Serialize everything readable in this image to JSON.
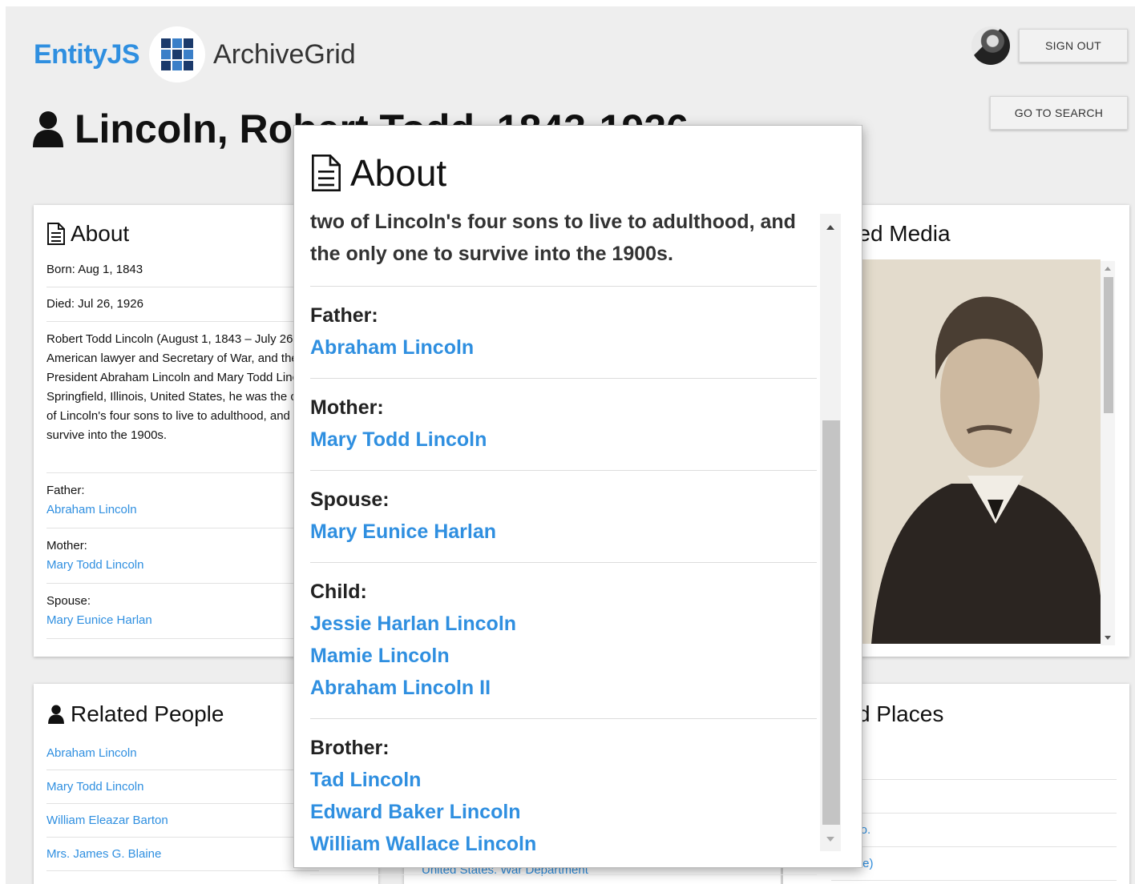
{
  "header": {
    "brand_primary": "EntityJS",
    "brand_secondary": "ArchiveGrid",
    "sign_out": "SIGN OUT",
    "go_to_search": "GO TO SEARCH"
  },
  "page_title": "Lincoln, Robert Todd, 1843-1926",
  "about_card": {
    "title": "About",
    "born": "Born: Aug 1, 1843",
    "died": "Died: Jul 26, 1926",
    "bio": "Robert Todd Lincoln (August 1, 1843 – July 26, 1926) was an American lawyer and Secretary of War, and the first son of President Abraham Lincoln and Mary Todd Lincoln. Born in Springfield, Illinois, United States, he was the only one of two of Lincoln's four sons to live to adulthood, and the only one to survive into the 1900s.",
    "father_label": "Father:",
    "father": "Abraham Lincoln",
    "mother_label": "Mother:",
    "mother": "Mary Todd Lincoln",
    "spouse_label": "Spouse:",
    "spouse": "Mary Eunice Harlan"
  },
  "related_people": {
    "title": "Related People",
    "items": [
      "Abraham Lincoln",
      "Mary Todd Lincoln",
      "William Eleazar Barton",
      "Mrs. James G. Blaine"
    ]
  },
  "related_media": {
    "title": "Related Media"
  },
  "related_places": {
    "title": "Related Places",
    "items": [
      "...es",
      "",
      "...cago.",
      "...State)"
    ]
  },
  "middle_card": {
    "link": "United States. War Department"
  },
  "modal": {
    "title": "About",
    "intro": "two of Lincoln's four sons to live to adulthood, and the only one to survive into the 1900s.",
    "sections": [
      {
        "label": "Father:",
        "links": [
          "Abraham Lincoln"
        ]
      },
      {
        "label": "Mother:",
        "links": [
          "Mary Todd Lincoln"
        ]
      },
      {
        "label": "Spouse:",
        "links": [
          "Mary Eunice Harlan"
        ]
      },
      {
        "label": "Child:",
        "links": [
          "Jessie Harlan Lincoln",
          "Mamie Lincoln",
          "Abraham Lincoln II"
        ]
      },
      {
        "label": "Brother:",
        "links": [
          "Tad Lincoln",
          "Edward Baker Lincoln",
          "William Wallace Lincoln"
        ]
      }
    ]
  },
  "colors": {
    "brand_blue": "#2f8fe0",
    "link_blue": "#2f8fe0",
    "logo_navy": "#1b3a6b",
    "background": "#eeeeee"
  },
  "icons": {
    "person": "person-icon",
    "document": "document-icon",
    "logo": "grid-logo-icon"
  }
}
